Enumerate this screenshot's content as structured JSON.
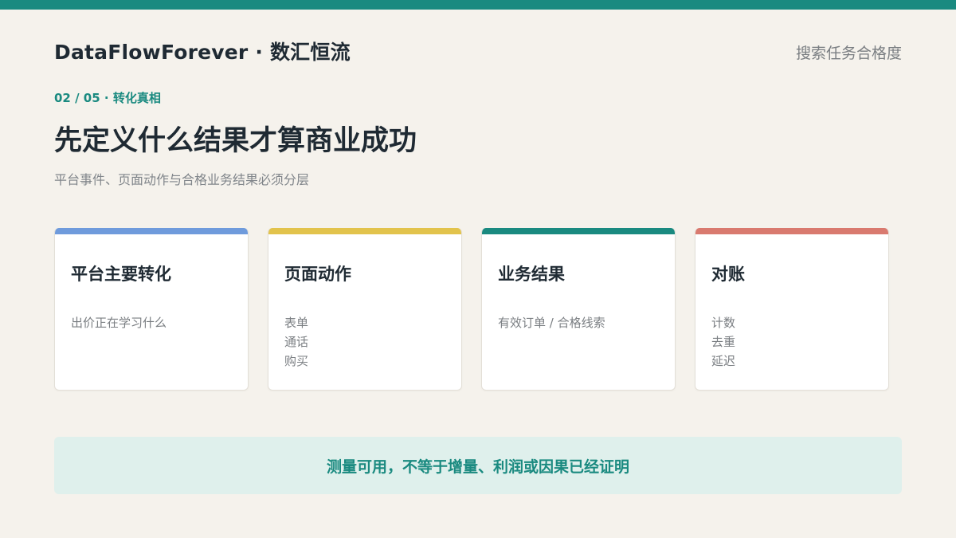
{
  "header": {
    "brand": "DataFlowForever · 数汇恒流",
    "top_right": "搜索任务合格度"
  },
  "slide": {
    "eyebrow": "02 / 05 · 转化真相",
    "title": "先定义什么结果才算商业成功",
    "subtitle": "平台事件、页面动作与合格业务结果必须分层"
  },
  "cards": [
    {
      "title": "平台主要转化",
      "items": [
        "出价正在学习什么"
      ],
      "accent": "#6f9bdc"
    },
    {
      "title": "页面动作",
      "items": [
        "表单",
        "通话",
        "购买"
      ],
      "accent": "#e2c34c"
    },
    {
      "title": "业务结果",
      "items": [
        "有效订单 / 合格线索"
      ],
      "accent": "#1a8a80"
    },
    {
      "title": "对账",
      "items": [
        "计数",
        "去重",
        "延迟"
      ],
      "accent": "#d97a6f"
    }
  ],
  "note": "测量可用，不等于增量、利润或因果已经证明",
  "colors": {
    "brand_teal": "#1a8a80",
    "background": "#f5f2ec",
    "note_background": "#dff0ec"
  }
}
